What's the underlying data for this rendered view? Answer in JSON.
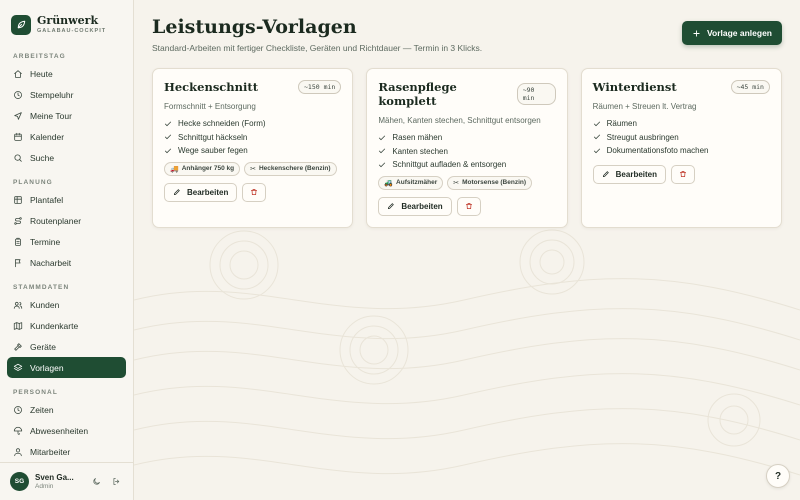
{
  "brand": {
    "name": "Grünwerk",
    "subtitle": "GALABAU-COCKPIT"
  },
  "sidebar": {
    "sections": [
      {
        "label": "ARBEITSTAG",
        "items": [
          {
            "label": "Heute",
            "icon": "home-icon"
          },
          {
            "label": "Stempeluhr",
            "icon": "clock-icon"
          },
          {
            "label": "Meine Tour",
            "icon": "navigation-icon"
          },
          {
            "label": "Kalender",
            "icon": "calendar-icon"
          },
          {
            "label": "Suche",
            "icon": "search-icon"
          }
        ]
      },
      {
        "label": "PLANUNG",
        "items": [
          {
            "label": "Plantafel",
            "icon": "grid-icon"
          },
          {
            "label": "Routenplaner",
            "icon": "route-icon"
          },
          {
            "label": "Termine",
            "icon": "clipboard-icon"
          },
          {
            "label": "Nacharbeit",
            "icon": "flag-icon"
          }
        ]
      },
      {
        "label": "STAMMDATEN",
        "items": [
          {
            "label": "Kunden",
            "icon": "users-icon"
          },
          {
            "label": "Kundenkarte",
            "icon": "map-icon"
          },
          {
            "label": "Geräte",
            "icon": "hammer-icon"
          },
          {
            "label": "Vorlagen",
            "icon": "layers-icon",
            "active": true
          }
        ]
      },
      {
        "label": "PERSONAL",
        "items": [
          {
            "label": "Zeiten",
            "icon": "clock-icon"
          },
          {
            "label": "Abwesenheiten",
            "icon": "umbrella-icon"
          },
          {
            "label": "Mitarbeiter",
            "icon": "user-icon"
          }
        ]
      }
    ]
  },
  "user": {
    "initials": "SG",
    "name": "Sven Ga...",
    "role": "Admin"
  },
  "header": {
    "title": "Leistungs-Vorlagen",
    "subtitle": "Standard-Arbeiten mit fertiger Checkliste, Geräten und Richtdauer — Termin in 3 Klicks.",
    "create_label": "Vorlage anlegen"
  },
  "cards": [
    {
      "title": "Heckenschnitt",
      "duration": "~150 min",
      "description": "Formschnitt + Entsorgung",
      "checklist": [
        "Hecke schneiden (Form)",
        "Schnittgut häckseln",
        "Wege sauber fegen"
      ],
      "tags": [
        {
          "icon": "🚚",
          "label": "Anhänger 750 kg"
        },
        {
          "icon": "✂",
          "label": "Heckenschere (Benzin)"
        }
      ],
      "edit_label": "Bearbeiten"
    },
    {
      "title": "Rasenpflege komplett",
      "duration": "~90 min",
      "description": "Mähen, Kanten stechen, Schnittgut entsorgen",
      "checklist": [
        "Rasen mähen",
        "Kanten stechen",
        "Schnittgut aufladen & entsorgen"
      ],
      "tags": [
        {
          "icon": "🚜",
          "label": "Aufsitzmäher"
        },
        {
          "icon": "✂",
          "label": "Motorsense (Benzin)"
        }
      ],
      "edit_label": "Bearbeiten"
    },
    {
      "title": "Winterdienst",
      "duration": "~45 min",
      "description": "Räumen + Streuen lt. Vertrag",
      "checklist": [
        "Räumen",
        "Streugut ausbringen",
        "Dokumentationsfoto machen"
      ],
      "tags": [],
      "edit_label": "Bearbeiten"
    }
  ],
  "help": {
    "label": "?"
  },
  "colors": {
    "accent": "#1f4d33",
    "background": "#f6f3ec",
    "card": "#fffdf9"
  }
}
